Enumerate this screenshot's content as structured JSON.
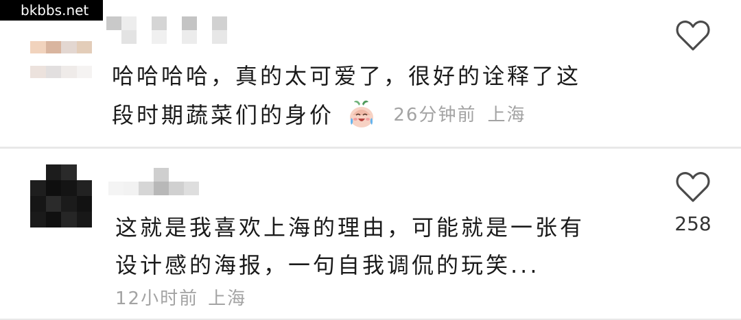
{
  "watermark": "bkbbs.net",
  "comments": [
    {
      "line1": "哈哈哈哈，真的太可爱了，很好的诠释了这",
      "line2": "段时期蔬菜们的身价",
      "emoji_icon": "crying-laughing-vegetable-emoji",
      "time": "26分钟前",
      "location": "上海",
      "like_icon": "heart-outline-icon",
      "like_count": ""
    },
    {
      "line1": "这就是我喜欢上海的理由，可能就是一张有",
      "line2": "设计感的海报，一句自我调侃的玩笑...",
      "time": "12小时前",
      "location": "上海",
      "like_icon": "heart-outline-icon",
      "like_count": "258"
    }
  ],
  "colors": {
    "text": "#1a1a1a",
    "meta": "#a3a3a3",
    "divider": "#e8e8e8"
  }
}
